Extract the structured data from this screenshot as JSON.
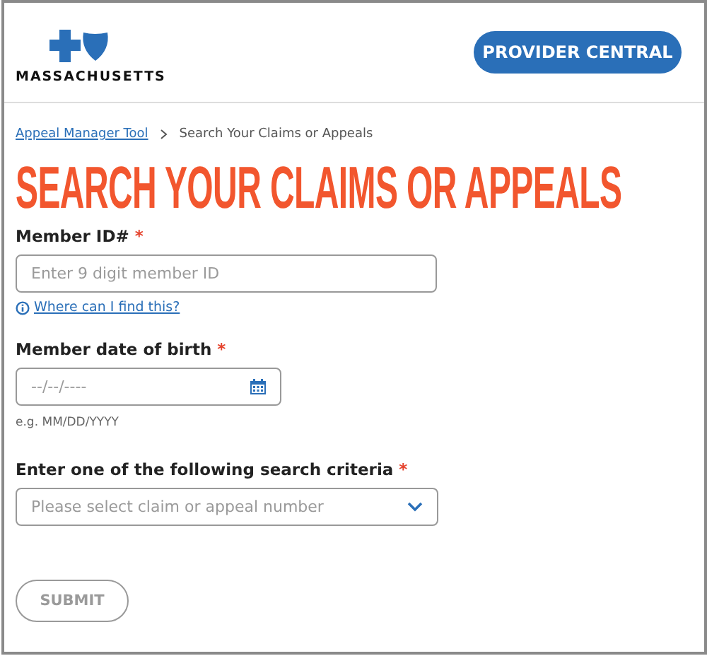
{
  "header": {
    "logo_text": "MASSACHUSETTS",
    "button": "PROVIDER CENTRAL"
  },
  "breadcrumb": [
    {
      "label": "Appeal Manager Tool",
      "kind": "link"
    },
    {
      "label": "Search Your Claims or Appeals",
      "kind": "current"
    }
  ],
  "title": "SEARCH YOUR CLAIMS OR APPEALS",
  "fields": [
    {
      "kind": "text",
      "label": "Member ID#",
      "required_mark": "*",
      "placeholder": "Enter 9 digit member ID",
      "help_link": "Where can I find this?"
    },
    {
      "kind": "date",
      "label": "Member date of birth",
      "required_mark": "*",
      "placeholder": "--/--/----",
      "hint": "e.g. MM/DD/YYYY"
    },
    {
      "kind": "select",
      "label": "Enter one of the following search criteria",
      "required_mark": "*",
      "placeholder": "Please select claim or appeal number"
    }
  ],
  "submit": {
    "label": "SUBMIT",
    "disabled": true
  }
}
